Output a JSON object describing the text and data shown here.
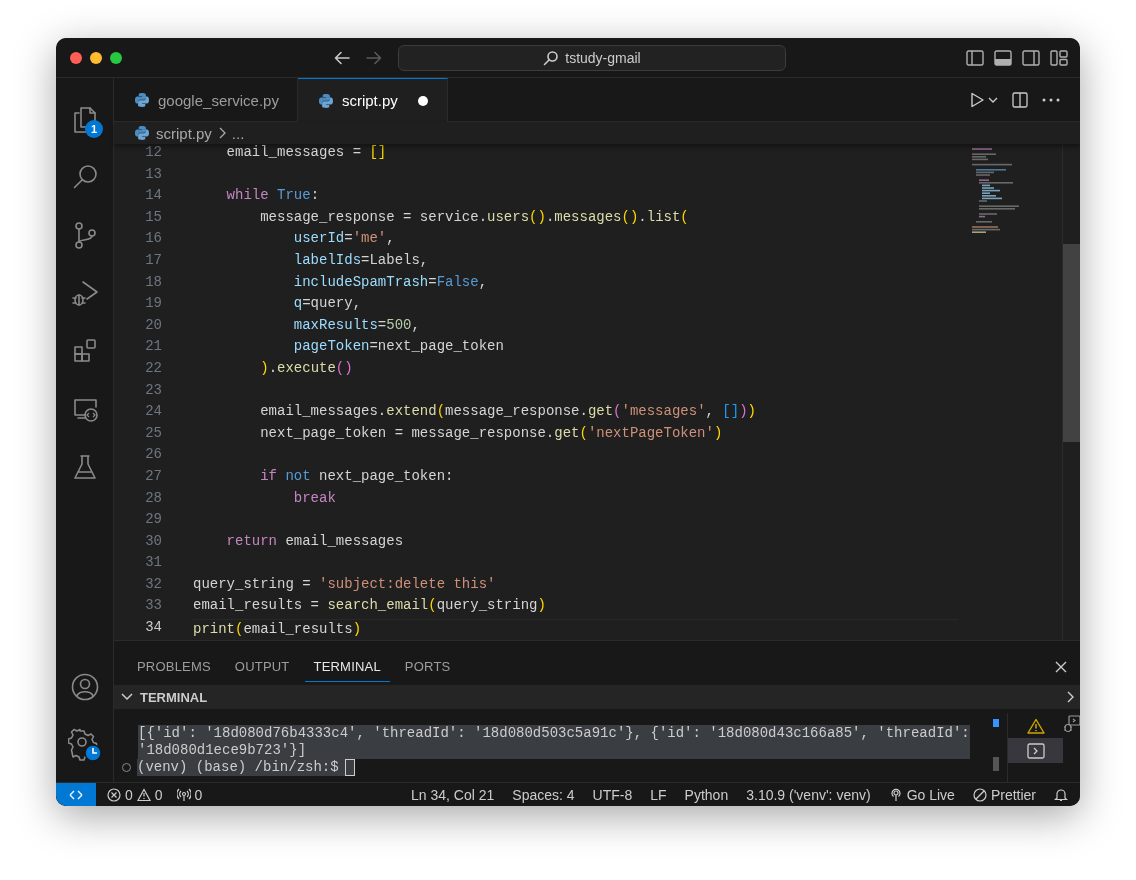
{
  "window": {
    "title": "tstudy-gmail"
  },
  "activity_bar": {
    "explorer_badge": "1"
  },
  "tabs": [
    {
      "label": "google_service.py",
      "selected": false,
      "modified": false
    },
    {
      "label": "script.py",
      "selected": true,
      "modified": true
    }
  ],
  "breadcrumb": [
    "script.py",
    "..."
  ],
  "editor": {
    "lines": [
      {
        "number": "12",
        "current": false,
        "tokens": [
          {
            "kind": "plain",
            "text": "    email_messages = "
          },
          {
            "kind": "bracket1",
            "text": "[]"
          }
        ]
      },
      {
        "number": "13",
        "current": false
      },
      {
        "number": "14",
        "current": false,
        "tokens": [
          {
            "kind": "keyword",
            "text": "    while"
          },
          {
            "kind": "constant",
            "text": " True"
          },
          {
            "kind": "plain",
            "text": ":"
          }
        ]
      },
      {
        "number": "15",
        "current": false,
        "tokens": [
          {
            "kind": "plain",
            "text": "        message_response = service."
          },
          {
            "kind": "function",
            "text": "users"
          },
          {
            "kind": "bracket1",
            "text": "()"
          },
          {
            "kind": "plain",
            "text": "."
          },
          {
            "kind": "function",
            "text": "messages"
          },
          {
            "kind": "bracket1",
            "text": "()"
          },
          {
            "kind": "plain",
            "text": "."
          },
          {
            "kind": "function",
            "text": "list"
          },
          {
            "kind": "bracket1",
            "text": "("
          }
        ]
      },
      {
        "number": "16",
        "current": false,
        "tokens": [
          {
            "kind": "parameter",
            "text": "            userId"
          },
          {
            "kind": "plain",
            "text": "="
          },
          {
            "kind": "string",
            "text": "'me'"
          },
          {
            "kind": "plain",
            "text": ","
          }
        ]
      },
      {
        "number": "17",
        "current": false,
        "tokens": [
          {
            "kind": "parameter",
            "text": "            labelIds"
          },
          {
            "kind": "plain",
            "text": "=Labels,"
          }
        ]
      },
      {
        "number": "18",
        "current": false,
        "tokens": [
          {
            "kind": "parameter",
            "text": "            includeSpamTrash"
          },
          {
            "kind": "plain",
            "text": "="
          },
          {
            "kind": "constant",
            "text": "False"
          },
          {
            "kind": "plain",
            "text": ","
          }
        ]
      },
      {
        "number": "19",
        "current": false,
        "tokens": [
          {
            "kind": "parameter",
            "text": "            q"
          },
          {
            "kind": "plain",
            "text": "=query,"
          }
        ]
      },
      {
        "number": "20",
        "current": false,
        "tokens": [
          {
            "kind": "parameter",
            "text": "            maxResults"
          },
          {
            "kind": "plain",
            "text": "="
          },
          {
            "kind": "number",
            "text": "500"
          },
          {
            "kind": "plain",
            "text": ","
          }
        ]
      },
      {
        "number": "21",
        "current": false,
        "tokens": [
          {
            "kind": "parameter",
            "text": "            pageToken"
          },
          {
            "kind": "plain",
            "text": "=next_page_token"
          }
        ]
      },
      {
        "number": "22",
        "current": false,
        "tokens": [
          {
            "kind": "bracket1",
            "text": "        )"
          },
          {
            "kind": "plain",
            "text": "."
          },
          {
            "kind": "function",
            "text": "execute"
          },
          {
            "kind": "bracket2",
            "text": "()"
          }
        ]
      },
      {
        "number": "23",
        "current": false
      },
      {
        "number": "24",
        "current": false,
        "tokens": [
          {
            "kind": "plain",
            "text": "        email_messages."
          },
          {
            "kind": "function",
            "text": "extend"
          },
          {
            "kind": "bracket1",
            "text": "("
          },
          {
            "kind": "plain",
            "text": "message_response."
          },
          {
            "kind": "function",
            "text": "get"
          },
          {
            "kind": "bracket2",
            "text": "("
          },
          {
            "kind": "string",
            "text": "'messages'"
          },
          {
            "kind": "plain",
            "text": ", "
          },
          {
            "kind": "bracket3",
            "text": "[]"
          },
          {
            "kind": "bracket2",
            "text": ")"
          },
          {
            "kind": "bracket1",
            "text": ")"
          }
        ]
      },
      {
        "number": "25",
        "current": false,
        "tokens": [
          {
            "kind": "plain",
            "text": "        next_page_token = message_response."
          },
          {
            "kind": "function",
            "text": "get"
          },
          {
            "kind": "bracket1",
            "text": "("
          },
          {
            "kind": "string",
            "text": "'nextPageToken'"
          },
          {
            "kind": "bracket1",
            "text": ")"
          }
        ]
      },
      {
        "number": "26",
        "current": false
      },
      {
        "number": "27",
        "current": false,
        "tokens": [
          {
            "kind": "keyword",
            "text": "        if"
          },
          {
            "kind": "constant",
            "text": " not"
          },
          {
            "kind": "plain",
            "text": " next_page_token:"
          }
        ]
      },
      {
        "number": "28",
        "current": false,
        "tokens": [
          {
            "kind": "keyword",
            "text": "            break"
          }
        ]
      },
      {
        "number": "29",
        "current": false
      },
      {
        "number": "30",
        "current": false,
        "tokens": [
          {
            "kind": "keyword",
            "text": "    return"
          },
          {
            "kind": "plain",
            "text": " email_messages"
          }
        ]
      },
      {
        "number": "31",
        "current": false
      },
      {
        "number": "32",
        "current": false,
        "tokens": [
          {
            "kind": "plain",
            "text": "query_string = "
          },
          {
            "kind": "string",
            "text": "'subject:delete this'"
          }
        ]
      },
      {
        "number": "33",
        "current": false,
        "tokens": [
          {
            "kind": "plain",
            "text": "email_results = "
          },
          {
            "kind": "function",
            "text": "search_email"
          },
          {
            "kind": "bracket1",
            "text": "("
          },
          {
            "kind": "plain",
            "text": "query_string"
          },
          {
            "kind": "bracket1",
            "text": ")"
          }
        ]
      },
      {
        "number": "34",
        "current": true,
        "tokens": [
          {
            "kind": "function",
            "text": "print"
          },
          {
            "kind": "bracket1",
            "text": "("
          },
          {
            "kind": "plain",
            "text": "email_results"
          },
          {
            "kind": "bracket1",
            "text": ")"
          }
        ]
      }
    ]
  },
  "panel": {
    "tabs": [
      {
        "label": "PROBLEMS",
        "selected": false
      },
      {
        "label": "OUTPUT",
        "selected": false
      },
      {
        "label": "TERMINAL",
        "selected": true
      },
      {
        "label": "PORTS",
        "selected": false
      }
    ],
    "section_title": "TERMINAL",
    "terminal": {
      "output": "[{'id': '18d080d76b4333c4', 'threadId': '18d080d503c5a91c'}, {'id': '18d080d43c166a85', 'threadId': '18d080d1ece9b723'}]",
      "prompt": "(venv) (base) /bin/zsh:$"
    }
  },
  "status_bar": {
    "errors": "0",
    "warnings": "0",
    "ports": "0",
    "position": "Ln 34, Col 21",
    "indentation": "Spaces: 4",
    "encoding": "UTF-8",
    "eol": "LF",
    "language": "Python",
    "interpreter": "3.10.9 ('venv': venv)",
    "live_server": "Go Live",
    "formatter": "Prettier"
  }
}
